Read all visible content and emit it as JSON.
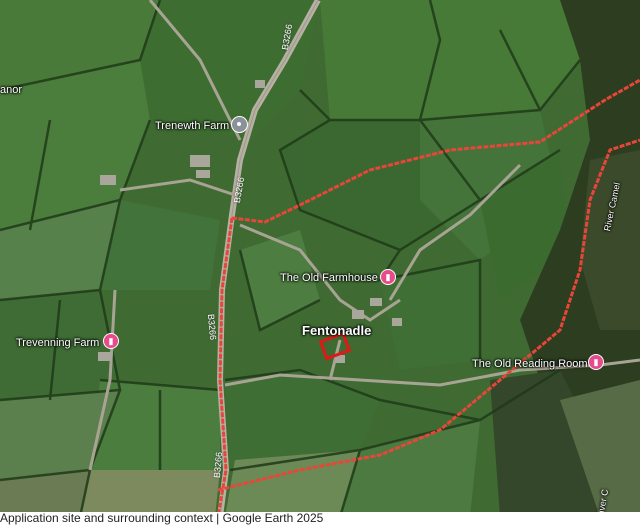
{
  "map": {
    "places": [
      {
        "name": "Trenewth Farm",
        "type": "place"
      },
      {
        "name": "The Old Farmhouse",
        "type": "hotel"
      },
      {
        "name": "Trevenning Farm",
        "type": "hotel"
      },
      {
        "name": "The Old Reading Room",
        "type": "hotel"
      }
    ],
    "village": "Fentonadle",
    "partial_labels": {
      "manor": "anor",
      "river_top": "River Camel",
      "river_bottom": "River C"
    },
    "roads": [
      "B3266",
      "B3266",
      "B3266",
      "B3266"
    ],
    "route_color": "#e8463a",
    "site_marker_color": "#e01818",
    "caption": "Application site and surrounding context | Google Earth 2025"
  }
}
